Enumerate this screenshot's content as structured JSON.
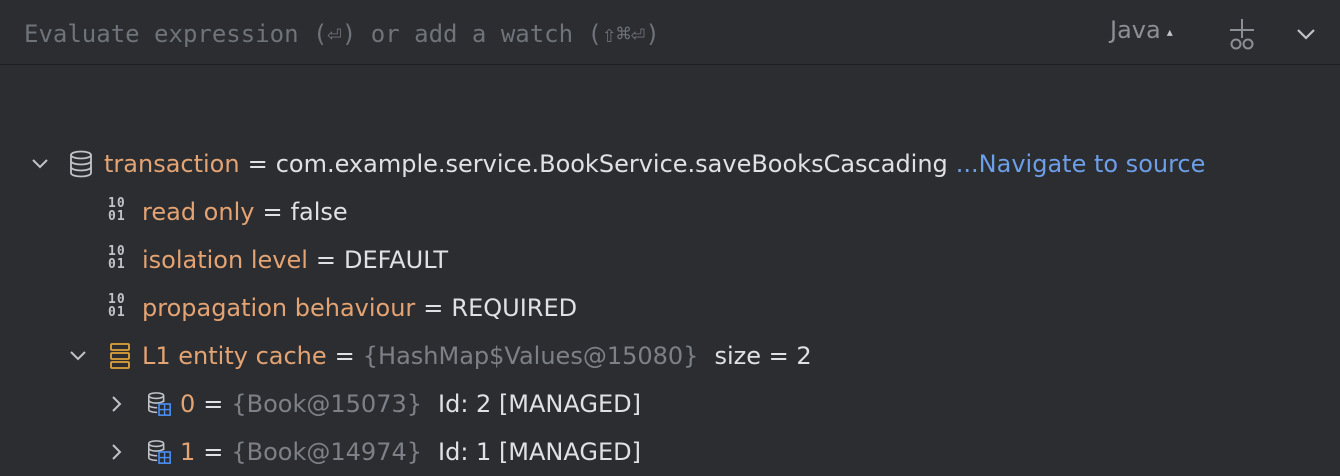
{
  "toolbar": {
    "placeholder": "Evaluate expression (⏎) or add a watch (⇧⌘⏎)",
    "language": "Java"
  },
  "tree": [
    {
      "name": "transaction",
      "value": "com.example.service.BookService.saveBooksCascading",
      "link": "...Navigate to source",
      "icon": "database-icon",
      "expanded": true
    },
    {
      "name": "read only",
      "value": "false",
      "icon": "binary-icon"
    },
    {
      "name": "isolation level",
      "value": "DEFAULT",
      "icon": "binary-icon"
    },
    {
      "name": "propagation behaviour",
      "value": "REQUIRED",
      "icon": "binary-icon"
    },
    {
      "name": "L1 entity cache",
      "ref": "{HashMap$Values@15080}",
      "extra": "size = 2",
      "icon": "stack-icon",
      "expanded": true
    },
    {
      "name": "0",
      "ref": "{Book@15073}",
      "extra": "Id: 2 [MANAGED]",
      "icon": "entity-icon",
      "expanded": false
    },
    {
      "name": "1",
      "ref": "{Book@14974}",
      "extra": "Id: 1 [MANAGED]",
      "icon": "entity-icon",
      "expanded": false
    }
  ],
  "colors": {
    "background": "#2b2d30",
    "name": "#e4a373",
    "link": "#6d9ee8",
    "ref": "#7d8086"
  }
}
